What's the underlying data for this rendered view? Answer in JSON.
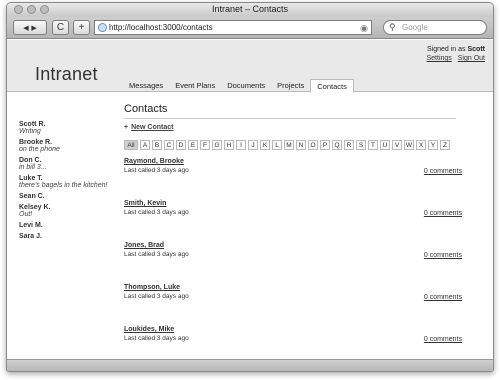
{
  "window": {
    "title": "Intranet – Contacts"
  },
  "toolbar": {
    "back": "◀",
    "forward": "▶",
    "reload": "C",
    "add": "+",
    "url": "http://localhost:3000/contacts",
    "search_placeholder": "Google"
  },
  "header": {
    "logo": "Intranet",
    "signed_in_text": "Signed in as",
    "signed_in_user": "Scott",
    "settings": "Settings",
    "sign_out": "Sign Out",
    "tabs": [
      {
        "label": "Messages",
        "active": false
      },
      {
        "label": "Event Plans",
        "active": false
      },
      {
        "label": "Documents",
        "active": false
      },
      {
        "label": "Projects",
        "active": false
      },
      {
        "label": "Contacts",
        "active": true
      }
    ]
  },
  "sidebar": {
    "people": [
      {
        "name": "Scott R.",
        "status": "Writing"
      },
      {
        "name": "Brooke R.",
        "status": "on the phone"
      },
      {
        "name": "Don C.",
        "status": "in bill 3..."
      },
      {
        "name": "Luke T.",
        "status": "there's bagels in the kitchen!"
      },
      {
        "name": "Sean C.",
        "status": ""
      },
      {
        "name": "Kelsey K.",
        "status": "Out!"
      },
      {
        "name": "Levi M.",
        "status": ""
      },
      {
        "name": "Sara J.",
        "status": ""
      }
    ]
  },
  "main": {
    "title": "Contacts",
    "new_contact": "New Contact",
    "letters": [
      "All",
      "A",
      "B",
      "C",
      "D",
      "E",
      "F",
      "G",
      "H",
      "I",
      "J",
      "K",
      "L",
      "M",
      "N",
      "O",
      "P",
      "Q",
      "R",
      "S",
      "T",
      "U",
      "V",
      "W",
      "X",
      "Y",
      "Z"
    ],
    "contacts": [
      {
        "name": "Raymond, Brooke",
        "last_called": "Last called 3 days ago",
        "comments": "0 comments"
      },
      {
        "name": "Smith, Kevin",
        "last_called": "Last called 3 days ago",
        "comments": "0 comments"
      },
      {
        "name": "Jones, Brad",
        "last_called": "Last called 3 days ago",
        "comments": "0 comments"
      },
      {
        "name": "Thompson, Luke",
        "last_called": "Last called 3 days ago",
        "comments": "0 comments"
      },
      {
        "name": "Loukides, Mike",
        "last_called": "Last called 3 days ago",
        "comments": "0 comments"
      }
    ]
  }
}
